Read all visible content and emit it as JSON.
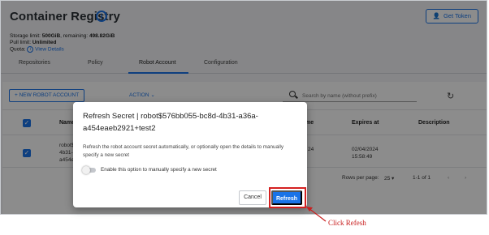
{
  "header": {
    "title": "Container Registry",
    "get_token": "Get Token"
  },
  "meta": {
    "storage_label": "Storage limit:",
    "storage_value": "500GiB",
    "remaining_label": ", remaining:",
    "remaining_value": "498.82GiB",
    "pull_label": "Pull limit:",
    "pull_value": "Unlimited",
    "quota_label": "Quota:",
    "quota_link": "View Details"
  },
  "tabs": [
    "Repositories",
    "Policy",
    "Robot Account",
    "Configuration"
  ],
  "toolbar": {
    "new_robot": "NEW ROBOT ACCOUNT",
    "action": "ACTION",
    "search_placeholder": "Search by name (without prefix)"
  },
  "table": {
    "headers": {
      "name": "Name",
      "name_fragment": "me",
      "expires": "Expires at",
      "description": "Description"
    },
    "row": {
      "name_lines": [
        "robot$",
        "4b31-",
        "a454e"
      ],
      "middle_fragment": "24",
      "expires_date": "02/04/2024",
      "expires_time": "15:58:49"
    }
  },
  "pagination": {
    "rows_per_page_label": "Rows per page:",
    "rows_per_page_value": "25",
    "range": "1-1 of 1"
  },
  "dialog": {
    "title": "Refresh Secret | robot$576bb055-bc8d-4b31-a36a-a454eaeb2921+test2",
    "description": "Refresh the robot account secret automatically, or optionally open the details to manually specify a new secret",
    "toggle_label": "Enable this option to manually specify a new secret",
    "cancel": "Cancel",
    "refresh": "Refresh"
  },
  "annotation": {
    "text": "Click Refesh",
    "color": "#c81e1e"
  },
  "colors": {
    "accent": "#1a73e8",
    "highlight": "#d42020"
  }
}
